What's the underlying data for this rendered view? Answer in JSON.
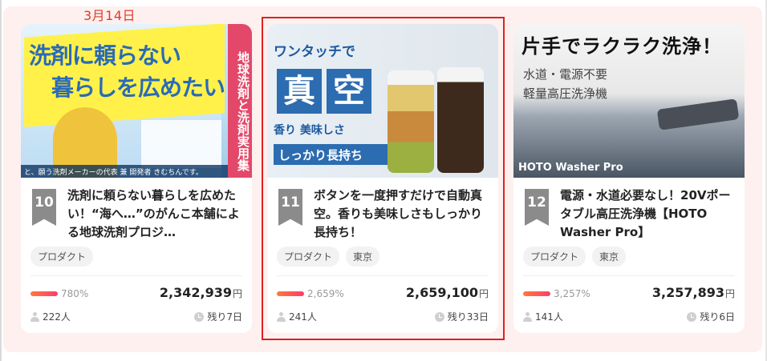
{
  "date_label": "3月14日",
  "currency": "円",
  "cards": [
    {
      "rank": "10",
      "title": "洗剤に頼らない暮らしを広めたい！“海へ…”のがんこ本舗による地球洗剤プロジ…",
      "tags": [
        "プロダクト"
      ],
      "percent": "780%",
      "percent_value": 780,
      "amount": "2,342,939",
      "people": "222人",
      "remaining": "残り7日",
      "thumb": {
        "line1": "洗剤に頼らない",
        "line2": "暮らしを広めたい！",
        "side": "地球洗剤と洗剤実用集",
        "caption": "と、願う洗剤メーカーの代表 兼 開発者 きむちんです。"
      }
    },
    {
      "rank": "11",
      "title": "ボタンを一度押すだけで自動真空。香りも美味しさもしっかり長持ち！",
      "tags": [
        "プロダクト",
        "東京"
      ],
      "percent": "2,659%",
      "percent_value": 2659,
      "amount": "2,659,100",
      "people": "241人",
      "remaining": "残り33日",
      "thumb": {
        "line1": "ワンタッチで",
        "big1": "真",
        "big2": "空",
        "line2": "香り 美味しさ",
        "line3": "しっかり長持ち"
      }
    },
    {
      "rank": "12",
      "title": "電源・水道必要なし！20Vポータブル高圧洗浄機【HOTO Washer Pro】",
      "tags": [
        "プロダクト",
        "東京"
      ],
      "percent": "3,257%",
      "percent_value": 3257,
      "amount": "3,257,893",
      "people": "141人",
      "remaining": "残り6日",
      "thumb": {
        "line1": "片手でラクラク洗浄！",
        "line2": "水道・電源不要",
        "line3": "軽量高圧洗浄機",
        "line4": "HOTO Washer Pro"
      }
    }
  ],
  "colors": {
    "date": "#e03a2a",
    "highlight_border": "#e02020",
    "progress": "#ff5a55",
    "rank_badge": "#8b8b8b"
  }
}
